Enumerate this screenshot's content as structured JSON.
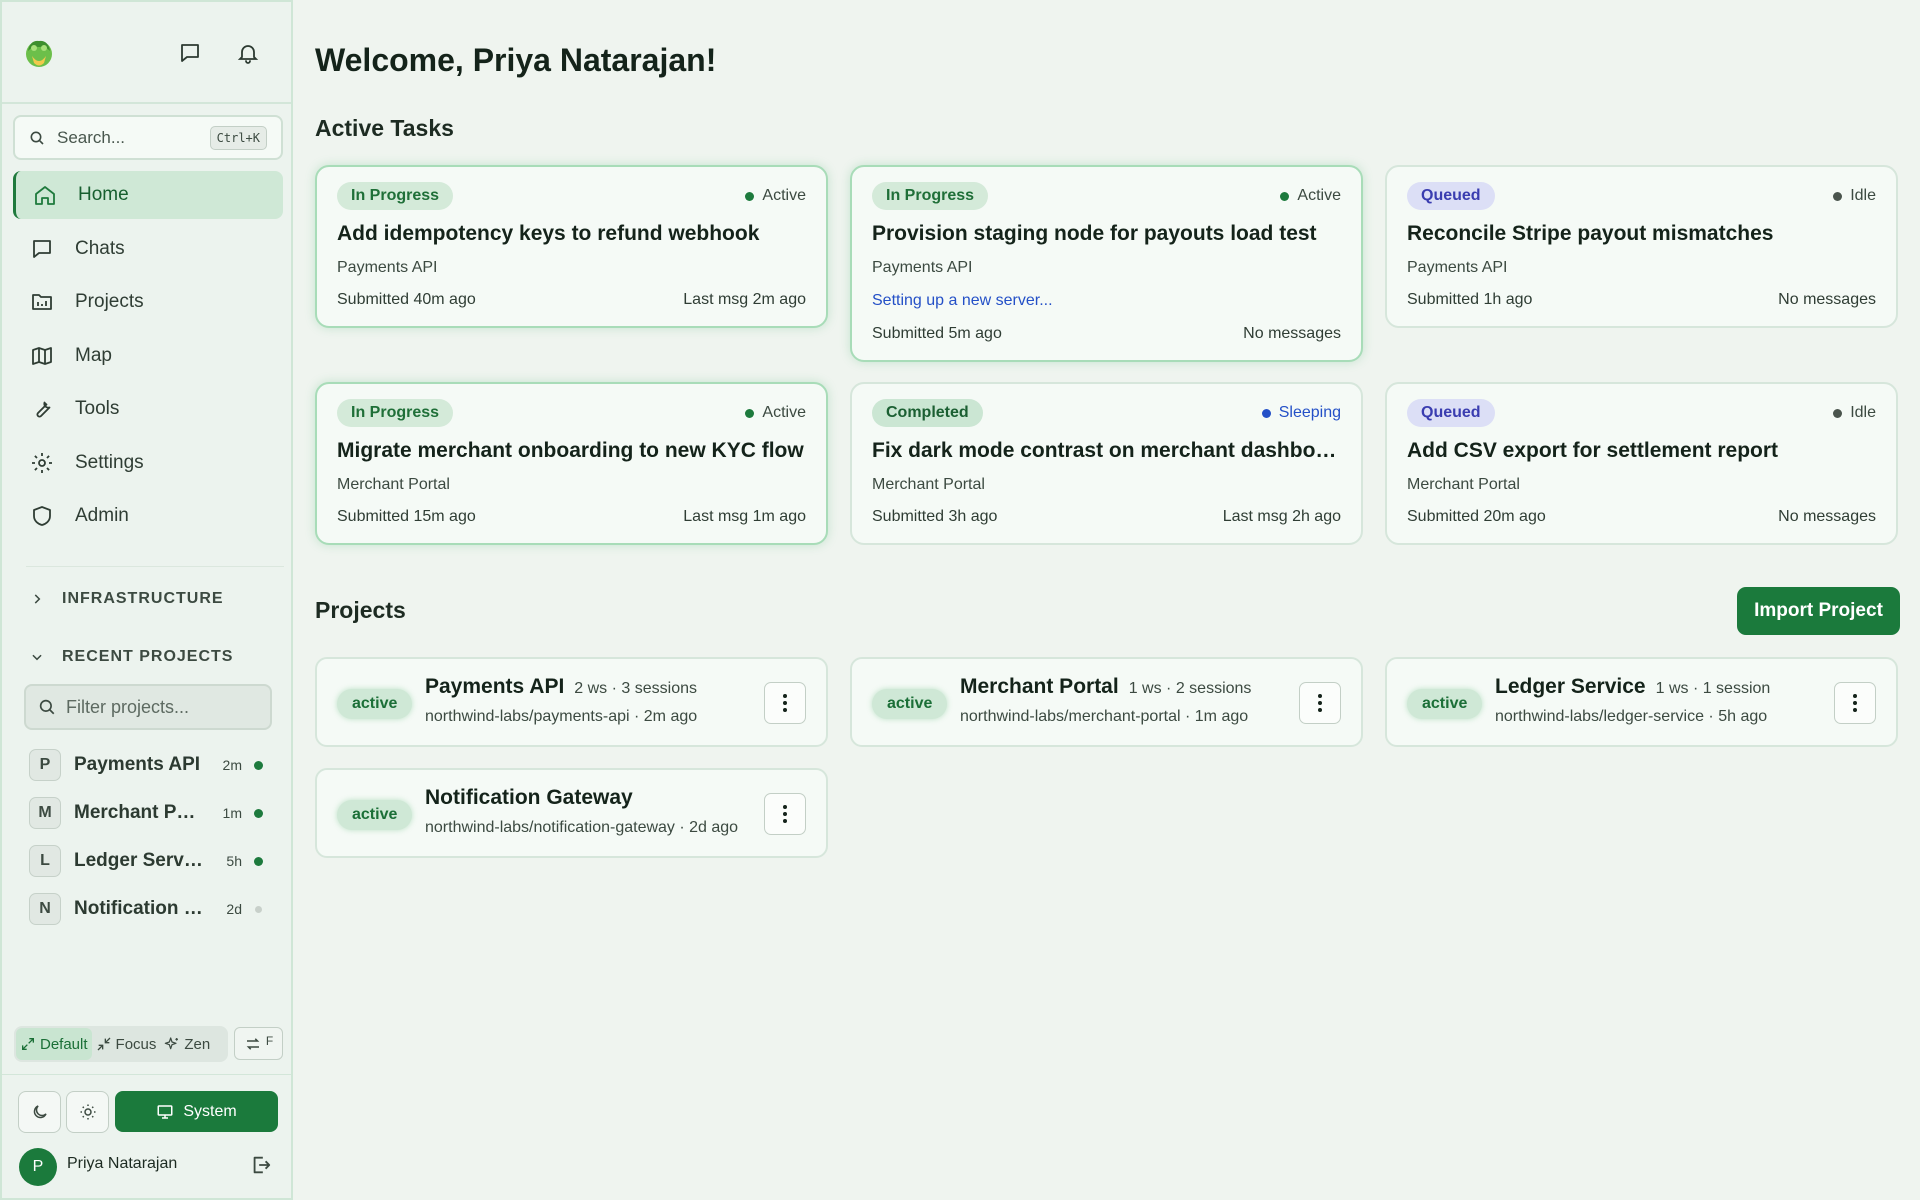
{
  "header": {
    "message_icon": "message-icon",
    "bell_icon": "bell-icon"
  },
  "search": {
    "placeholder": "Search...",
    "shortcut": "Ctrl+K"
  },
  "nav": {
    "items": [
      {
        "label": "Home",
        "icon": "home-icon",
        "active": true
      },
      {
        "label": "Chats",
        "icon": "chat-icon"
      },
      {
        "label": "Projects",
        "icon": "folder-icon"
      },
      {
        "label": "Map",
        "icon": "map-icon"
      },
      {
        "label": "Tools",
        "icon": "wrench-icon"
      },
      {
        "label": "Settings",
        "icon": "gear-icon"
      },
      {
        "label": "Admin",
        "icon": "shield-icon"
      }
    ]
  },
  "sections": {
    "infrastructure": "INFRASTRUCTURE",
    "recent_projects": "RECENT PROJECTS"
  },
  "filter": {
    "placeholder": "Filter projects..."
  },
  "recent_projects": [
    {
      "initial": "P",
      "name": "Payments API",
      "time": "2m",
      "online": true
    },
    {
      "initial": "M",
      "name": "Merchant Portal",
      "time": "1m",
      "online": true
    },
    {
      "initial": "L",
      "name": "Ledger Service",
      "time": "5h",
      "online": true
    },
    {
      "initial": "N",
      "name": "Notification Gateway",
      "time": "2d",
      "online": false
    }
  ],
  "modes": {
    "default": "Default",
    "focus": "Focus",
    "zen": "Zen",
    "swap_key": "F",
    "active": "Default"
  },
  "theme": {
    "system_label": "System",
    "selected": "System"
  },
  "user": {
    "initial": "P",
    "name": "Priya Natarajan"
  },
  "main": {
    "welcome": "Welcome, Priya Natarajan!",
    "active_tasks_heading": "Active Tasks",
    "projects_heading": "Projects",
    "import_button": "Import Project"
  },
  "tasks": [
    {
      "status": "In Progress",
      "state": "Active",
      "title": "Add idempotency keys to refund webhook",
      "project": "Payments API",
      "submitted": "Submitted 40m ago",
      "last": "Last msg 2m ago"
    },
    {
      "status": "In Progress",
      "state": "Active",
      "title": "Provision staging node for payouts load test",
      "project": "Payments API",
      "note": "Setting up a new server...",
      "submitted": "Submitted 5m ago",
      "last": "No messages"
    },
    {
      "status": "Queued",
      "state": "Idle",
      "title": "Reconcile Stripe payout mismatches",
      "project": "Payments API",
      "submitted": "Submitted 1h ago",
      "last": "No messages"
    },
    {
      "status": "In Progress",
      "state": "Active",
      "title": "Migrate merchant onboarding to new KYC flow",
      "project": "Merchant Portal",
      "submitted": "Submitted 15m ago",
      "last": "Last msg 1m ago"
    },
    {
      "status": "Completed",
      "state": "Sleeping",
      "title": "Fix dark mode contrast on merchant dashboard",
      "project": "Merchant Portal",
      "submitted": "Submitted 3h ago",
      "last": "Last msg 2h ago"
    },
    {
      "status": "Queued",
      "state": "Idle",
      "title": "Add CSV export for settlement report",
      "project": "Merchant Portal",
      "submitted": "Submitted 20m ago",
      "last": "No messages"
    }
  ],
  "projects": [
    {
      "status": "active",
      "name": "Payments API",
      "meta": "2 ws · 3 sessions",
      "repo": "northwind-labs/payments-api · 2m ago"
    },
    {
      "status": "active",
      "name": "Merchant Portal",
      "meta": "1 ws · 2 sessions",
      "repo": "northwind-labs/merchant-portal · 1m ago"
    },
    {
      "status": "active",
      "name": "Ledger Service",
      "meta": "1 ws · 1 session",
      "repo": "northwind-labs/ledger-service · 5h ago"
    },
    {
      "status": "active",
      "name": "Notification Gateway",
      "meta": "",
      "repo": "northwind-labs/notification-gateway · 2d ago"
    }
  ],
  "colors": {
    "brand": "#1b7a3c",
    "active_dot": "#1d7a3d",
    "idle_dot": "#4a544d",
    "sleeping_dot": "#2450c7",
    "queued_text": "#3a3db0",
    "background": "#eff4ef"
  }
}
